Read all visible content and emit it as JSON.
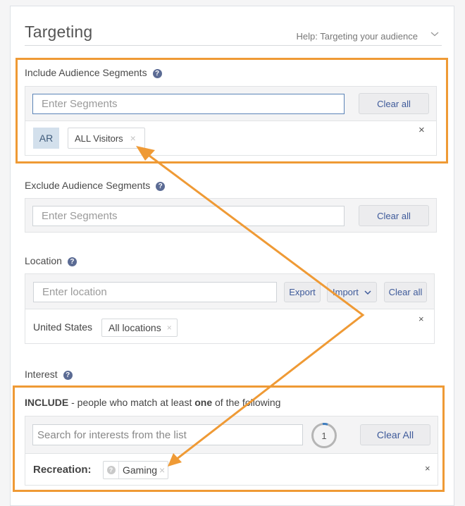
{
  "header": {
    "title": "Targeting",
    "help_link": "Help: Targeting your audience"
  },
  "include_segments": {
    "label": "Include Audience Segments",
    "input_placeholder": "Enter Segments",
    "clear_label": "Clear all",
    "badge": "AR",
    "chips": [
      {
        "label": "ALL Visitors"
      }
    ],
    "remove_label": "×"
  },
  "exclude_segments": {
    "label": "Exclude Audience Segments",
    "input_placeholder": "Enter Segments",
    "clear_label": "Clear all"
  },
  "location": {
    "label": "Location",
    "input_placeholder": "Enter location",
    "export_label": "Export",
    "import_label": "Import",
    "clear_label": "Clear all",
    "country": "United States",
    "chips": [
      {
        "label": "All locations"
      }
    ],
    "remove_label": "×"
  },
  "interest": {
    "label": "Interest",
    "include_keyword": "INCLUDE",
    "include_text_pre": " - people who match at least ",
    "include_text_bold": "one",
    "include_text_post": " of the following",
    "search_placeholder": "Search for interests from the list",
    "count": "1",
    "clear_label": "Clear All",
    "category": "Recreation:",
    "chips": [
      {
        "label": "Gaming"
      }
    ],
    "remove_label": "×"
  },
  "icons": {
    "help": "?",
    "chip_remove": "×"
  },
  "colors": {
    "annotation": "#ef9a35",
    "link": "#3e5a9a",
    "help_icon": "#5b6b94",
    "badge_bg": "#d3e0ec",
    "focus_border": "#5b83b7"
  }
}
